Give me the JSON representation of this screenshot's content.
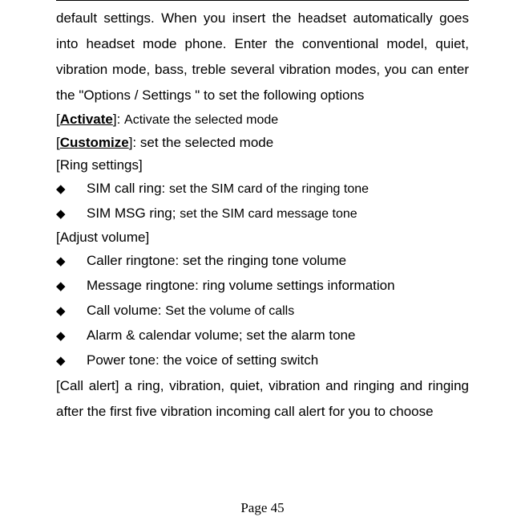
{
  "intro": "default settings. When you insert the headset automatically goes into headset mode phone. Enter the conventional model, quiet, vibration mode, bass, treble several vibration modes, you can enter the \"Options / Settings \" to set the following options",
  "activate": {
    "label": "Activate",
    "desc": "Activate the selected mode"
  },
  "customize": {
    "label": "Customize",
    "desc": "set the selected mode"
  },
  "ringSettings": {
    "header": "[Ring settings]",
    "items": [
      {
        "prefix": "SIM call ring: ",
        "desc": "set the SIM card of the ringing tone"
      },
      {
        "prefix": "SIM MSG ring; ",
        "desc": "set the SIM card message tone"
      }
    ]
  },
  "adjustVolume": {
    "header": "[Adjust volume]",
    "items": [
      {
        "text": "Caller ringtone: set the ringing tone volume"
      },
      {
        "text": "Message ringtone: ring volume settings information"
      },
      {
        "prefix": "Call volume: ",
        "desc": "Set the volume of calls"
      },
      {
        "text": "Alarm & calendar volume; set the alarm tone"
      },
      {
        "text": "Power tone: the voice of setting switch"
      }
    ]
  },
  "callAlert": "[Call alert] a ring, vibration, quiet, vibration and ringing and ringing after the first five vibration incoming call alert for you to choose",
  "pageNum": "Page 45"
}
